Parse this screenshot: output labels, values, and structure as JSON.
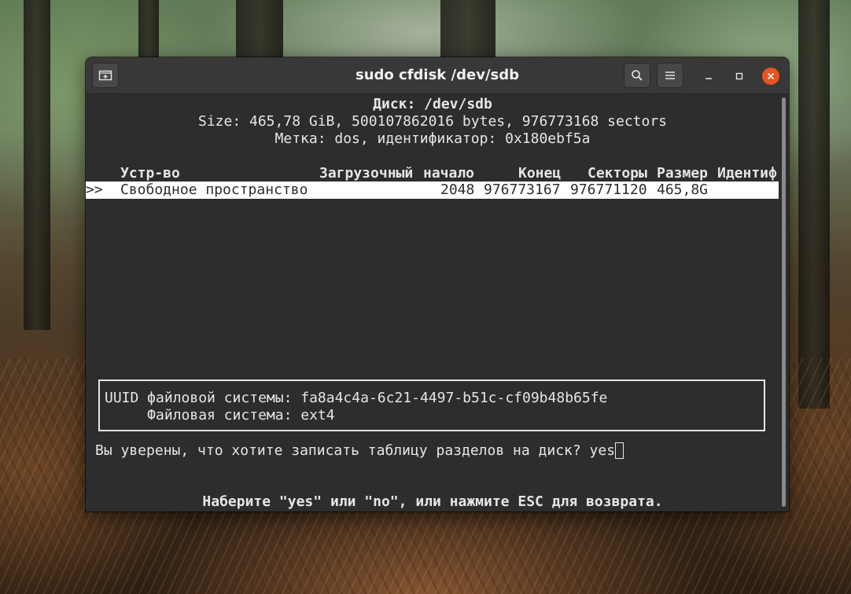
{
  "window": {
    "title": "sudo cfdisk /dev/sdb"
  },
  "terminal": {
    "disk_line": "Диск: /dev/sdb",
    "size_line": "Size: 465,78 GiB, 500107862016 bytes, 976773168 sectors",
    "label_line": "Метка: dos, идентификатор: 0x180ebf5a",
    "columns": [
      "Устр-во",
      "Загрузочный",
      "начало",
      "Конец",
      "Секторы",
      "Размер",
      "Идентиф"
    ],
    "selected_row": {
      "marker": ">>",
      "device": "Свободное пространство",
      "start": "2048",
      "end": "976773167",
      "sectors": "976771120",
      "size": "465,8G"
    },
    "info": {
      "uuid_line": "UUID файловой системы: fa8a4c4a-6c21-4497-b51c-cf09b48b65fe",
      "fs_line": "     Файловая система: ext4"
    },
    "prompt": "Вы уверены, что хотите записать таблицу разделов на диск? ",
    "input_value": "yes",
    "hint": "Наберите \"yes\" или \"no\", или нажмите ESC для возврата."
  },
  "colors": {
    "terminal_bg": "#2d2d2d",
    "titlebar_bg": "#383838",
    "close_accent": "#e95420",
    "text": "#e6e6e6"
  },
  "icons": {
    "new_tab": "new-tab-icon",
    "search": "search-icon",
    "menu": "hamburger-menu-icon",
    "minimize": "minimize-icon",
    "maximize": "maximize-icon",
    "close": "close-icon"
  }
}
